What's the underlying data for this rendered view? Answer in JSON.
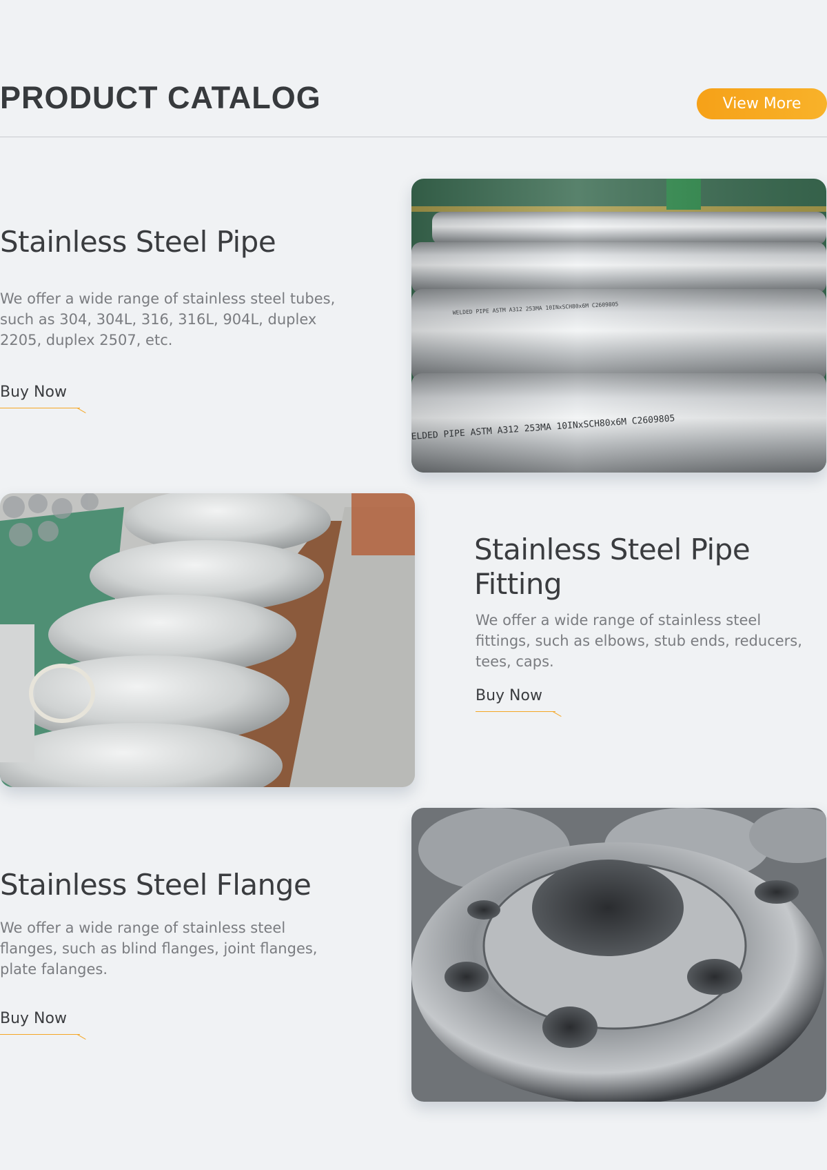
{
  "catalog": {
    "title": "PRODUCT CATALOG",
    "view_more_label": "View More",
    "accent_color": "#f6a118"
  },
  "products": [
    {
      "name": "Stainless Steel Pipe",
      "description": "We offer a wide range of stainless steel tubes, such as 304, 304L, 316, 316L, 904L, duplex 2205, duplex 2507, etc.",
      "buy_label": "Buy Now",
      "image_text_1": "WELDED PIPE ASTM A312 253MA 10INxSCH80x6M C2609805",
      "image_text_2": "ELDED PIPE ASTM A312 253MA 10INxSCH80x6M C2609805"
    },
    {
      "name": "Stainless Steel Pipe Fitting",
      "description": "We offer a wide range of stainless steel fittings, such as elbows, stub ends, reducers, tees, caps.",
      "buy_label": "Buy Now"
    },
    {
      "name": "Stainless Steel Flange",
      "description": "We offer a wide range of stainless steel flanges, such as blind flanges, joint flanges, plate falanges.",
      "buy_label": "Buy Now"
    }
  ]
}
